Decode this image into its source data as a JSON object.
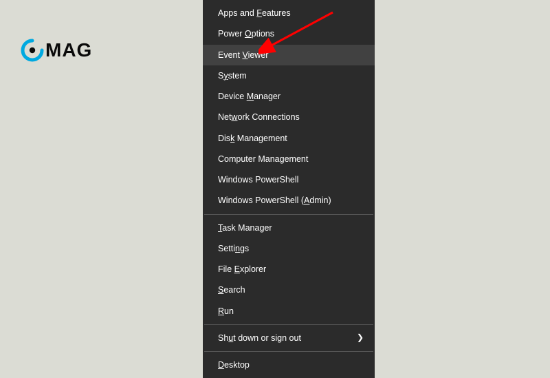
{
  "logo": {
    "text": "MAG"
  },
  "menu": {
    "groups": [
      [
        {
          "pre": "Apps and ",
          "u": "F",
          "post": "eatures"
        },
        {
          "pre": "Power ",
          "u": "O",
          "post": "ptions"
        },
        {
          "pre": "Event ",
          "u": "V",
          "post": "iewer",
          "highlighted": true
        },
        {
          "pre": "S",
          "u": "y",
          "post": "stem"
        },
        {
          "pre": "Device ",
          "u": "M",
          "post": "anager"
        },
        {
          "pre": "Net",
          "u": "w",
          "post": "ork Connections"
        },
        {
          "pre": "Dis",
          "u": "k",
          "post": " Management"
        },
        {
          "pre": "Computer Mana",
          "u": "g",
          "post": "ement"
        },
        {
          "pre": "Windows PowerShell",
          "u": "",
          "post": ""
        },
        {
          "pre": "Windows PowerShell (",
          "u": "A",
          "post": "dmin)"
        }
      ],
      [
        {
          "pre": "",
          "u": "T",
          "post": "ask Manager"
        },
        {
          "pre": "Setti",
          "u": "n",
          "post": "gs"
        },
        {
          "pre": "File ",
          "u": "E",
          "post": "xplorer"
        },
        {
          "pre": "",
          "u": "S",
          "post": "earch"
        },
        {
          "pre": "",
          "u": "R",
          "post": "un"
        }
      ],
      [
        {
          "pre": "Sh",
          "u": "u",
          "post": "t down or sign out",
          "submenu": true
        }
      ],
      [
        {
          "pre": "",
          "u": "D",
          "post": "esktop"
        }
      ]
    ]
  },
  "colors": {
    "accent": "#00a9e0",
    "arrow": "#ff0000",
    "menu_bg": "#2b2b2b",
    "menu_highlight": "#414141"
  }
}
